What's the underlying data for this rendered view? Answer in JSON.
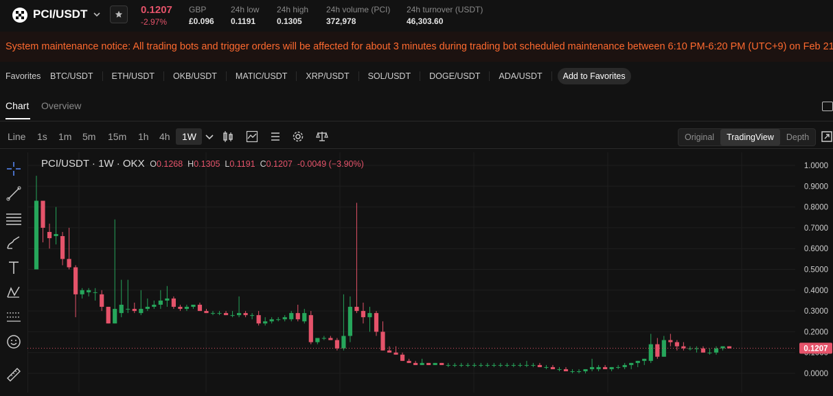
{
  "header": {
    "pair": "PCI/USDT",
    "price": "0.1207",
    "change": "-2.97%",
    "stats": [
      {
        "label": "GBP",
        "value": "£0.096"
      },
      {
        "label": "24h low",
        "value": "0.1191"
      },
      {
        "label": "24h high",
        "value": "0.1305"
      },
      {
        "label": "24h volume (PCI)",
        "value": "372,978"
      },
      {
        "label": "24h turnover (USDT)",
        "value": "46,303.60"
      }
    ]
  },
  "notice": "System maintenance notice: All trading bots and trigger orders will be affected for about 3 minutes during trading bot scheduled maintenance between 6:10 PM-6:20 PM (UTC+9) on Feb 21,",
  "favorites": {
    "label": "Favorites",
    "items": [
      "BTC/USDT",
      "ETH/USDT",
      "OKB/USDT",
      "MATIC/USDT",
      "XRP/USDT",
      "SOL/USDT",
      "DOGE/USDT",
      "ADA/USDT"
    ],
    "add_label": "Add to Favorites"
  },
  "tabs": {
    "chart": "Chart",
    "overview": "Overview"
  },
  "toolbar": {
    "timeframes": [
      "Line",
      "1s",
      "1m",
      "5m",
      "15m",
      "1h",
      "4h",
      "1W"
    ],
    "active_timeframe": "1W",
    "views": [
      "Original",
      "TradingView",
      "Depth"
    ],
    "active_view": "TradingView"
  },
  "colors": {
    "up": "#26a65b",
    "down": "#e5536a",
    "notice": "#ff6a2f"
  },
  "chart_data": {
    "type": "candlestick",
    "title": "PCI/USDT · 1W · OKX",
    "ohlc": {
      "o": "0.1268",
      "h": "0.1305",
      "l": "0.1191",
      "c": "0.1207",
      "chg": "-0.0049 (−3.90%)"
    },
    "y_axis_ticks": [
      "1.0000",
      "0.9000",
      "0.8000",
      "0.7000",
      "0.6000",
      "0.5000",
      "0.4000",
      "0.3000",
      "0.2000",
      "0.1000",
      "0.0000"
    ],
    "ylim": [
      0,
      1.0
    ],
    "last_price_label": "0.1207",
    "candles": [
      [
        0.5,
        0.95,
        0.5,
        0.83
      ],
      [
        0.83,
        0.83,
        0.63,
        0.7
      ],
      [
        0.68,
        0.72,
        0.6,
        0.65
      ],
      [
        0.66,
        0.8,
        0.62,
        0.67
      ],
      [
        0.66,
        0.68,
        0.52,
        0.55
      ],
      [
        0.55,
        0.7,
        0.5,
        0.51
      ],
      [
        0.51,
        0.52,
        0.27,
        0.38
      ],
      [
        0.38,
        0.41,
        0.36,
        0.4
      ],
      [
        0.39,
        0.41,
        0.37,
        0.4
      ],
      [
        0.39,
        0.41,
        0.35,
        0.39
      ],
      [
        0.38,
        0.4,
        0.3,
        0.32
      ],
      [
        0.32,
        0.32,
        0.24,
        0.24
      ],
      [
        0.24,
        0.74,
        0.24,
        0.31
      ],
      [
        0.29,
        0.45,
        0.27,
        0.33
      ],
      [
        0.31,
        0.45,
        0.29,
        0.31
      ],
      [
        0.31,
        0.34,
        0.29,
        0.3
      ],
      [
        0.29,
        0.4,
        0.28,
        0.31
      ],
      [
        0.31,
        0.36,
        0.3,
        0.32
      ],
      [
        0.32,
        0.35,
        0.31,
        0.33
      ],
      [
        0.33,
        0.4,
        0.31,
        0.35
      ],
      [
        0.35,
        0.42,
        0.32,
        0.36
      ],
      [
        0.36,
        0.37,
        0.31,
        0.32
      ],
      [
        0.32,
        0.33,
        0.3,
        0.31
      ],
      [
        0.31,
        0.33,
        0.3,
        0.32
      ],
      [
        0.32,
        0.33,
        0.31,
        0.33
      ],
      [
        0.33,
        0.34,
        0.3,
        0.3
      ],
      [
        0.3,
        0.31,
        0.29,
        0.29
      ],
      [
        0.29,
        0.3,
        0.28,
        0.29
      ],
      [
        0.29,
        0.3,
        0.28,
        0.29
      ],
      [
        0.29,
        0.3,
        0.28,
        0.28
      ],
      [
        0.28,
        0.3,
        0.27,
        0.28
      ],
      [
        0.28,
        0.37,
        0.27,
        0.29
      ],
      [
        0.29,
        0.3,
        0.27,
        0.28
      ],
      [
        0.28,
        0.29,
        0.26,
        0.28
      ],
      [
        0.28,
        0.3,
        0.23,
        0.24
      ],
      [
        0.24,
        0.27,
        0.23,
        0.25
      ],
      [
        0.25,
        0.27,
        0.24,
        0.26
      ],
      [
        0.26,
        0.27,
        0.25,
        0.26
      ],
      [
        0.26,
        0.28,
        0.25,
        0.27
      ],
      [
        0.26,
        0.3,
        0.25,
        0.29
      ],
      [
        0.29,
        0.33,
        0.25,
        0.26
      ],
      [
        0.25,
        0.31,
        0.24,
        0.29
      ],
      [
        0.28,
        0.3,
        0.14,
        0.15
      ],
      [
        0.15,
        0.17,
        0.14,
        0.17
      ],
      [
        0.17,
        0.18,
        0.16,
        0.17
      ],
      [
        0.17,
        0.18,
        0.16,
        0.16
      ],
      [
        0.16,
        0.17,
        0.11,
        0.12
      ],
      [
        0.12,
        0.38,
        0.11,
        0.18
      ],
      [
        0.18,
        0.37,
        0.15,
        0.32
      ],
      [
        0.32,
        0.82,
        0.29,
        0.3
      ],
      [
        0.3,
        0.34,
        0.24,
        0.27
      ],
      [
        0.27,
        0.32,
        0.2,
        0.29
      ],
      [
        0.29,
        0.3,
        0.18,
        0.2
      ],
      [
        0.2,
        0.25,
        0.11,
        0.11
      ],
      [
        0.11,
        0.13,
        0.1,
        0.1
      ],
      [
        0.1,
        0.13,
        0.09,
        0.09
      ],
      [
        0.09,
        0.1,
        0.06,
        0.06
      ],
      [
        0.06,
        0.07,
        0.05,
        0.05
      ],
      [
        0.05,
        0.06,
        0.04,
        0.04
      ],
      [
        0.04,
        0.07,
        0.04,
        0.05
      ],
      [
        0.05,
        0.05,
        0.04,
        0.04
      ],
      [
        0.04,
        0.05,
        0.04,
        0.05
      ],
      [
        0.05,
        0.05,
        0.04,
        0.04
      ],
      [
        0.04,
        0.05,
        0.03,
        0.04
      ],
      [
        0.04,
        0.05,
        0.03,
        0.04
      ],
      [
        0.04,
        0.05,
        0.03,
        0.04
      ],
      [
        0.04,
        0.05,
        0.03,
        0.04
      ],
      [
        0.04,
        0.05,
        0.03,
        0.04
      ],
      [
        0.04,
        0.05,
        0.03,
        0.04
      ],
      [
        0.04,
        0.05,
        0.03,
        0.04
      ],
      [
        0.04,
        0.05,
        0.03,
        0.04
      ],
      [
        0.04,
        0.05,
        0.03,
        0.04
      ],
      [
        0.04,
        0.05,
        0.03,
        0.04
      ],
      [
        0.04,
        0.05,
        0.03,
        0.04
      ],
      [
        0.04,
        0.05,
        0.03,
        0.04
      ],
      [
        0.04,
        0.06,
        0.03,
        0.04
      ],
      [
        0.04,
        0.05,
        0.03,
        0.04
      ],
      [
        0.04,
        0.05,
        0.03,
        0.03
      ],
      [
        0.03,
        0.04,
        0.02,
        0.03
      ],
      [
        0.03,
        0.04,
        0.02,
        0.02
      ],
      [
        0.02,
        0.03,
        0.01,
        0.02
      ],
      [
        0.02,
        0.03,
        0.01,
        0.01
      ],
      [
        0.01,
        0.02,
        0.0,
        0.01
      ],
      [
        0.01,
        0.02,
        0.0,
        0.01
      ],
      [
        0.01,
        0.02,
        0.0,
        0.02
      ],
      [
        0.02,
        0.07,
        0.01,
        0.03
      ],
      [
        0.02,
        0.04,
        0.01,
        0.03
      ],
      [
        0.03,
        0.04,
        0.02,
        0.02
      ],
      [
        0.02,
        0.03,
        0.01,
        0.03
      ],
      [
        0.03,
        0.04,
        0.02,
        0.03
      ],
      [
        0.03,
        0.05,
        0.02,
        0.04
      ],
      [
        0.04,
        0.05,
        0.02,
        0.05
      ],
      [
        0.05,
        0.06,
        0.03,
        0.06
      ],
      [
        0.06,
        0.07,
        0.04,
        0.07
      ],
      [
        0.06,
        0.19,
        0.05,
        0.14
      ],
      [
        0.14,
        0.17,
        0.07,
        0.08
      ],
      [
        0.08,
        0.18,
        0.08,
        0.16
      ],
      [
        0.16,
        0.19,
        0.13,
        0.15
      ],
      [
        0.15,
        0.16,
        0.11,
        0.13
      ],
      [
        0.13,
        0.15,
        0.11,
        0.12
      ],
      [
        0.12,
        0.13,
        0.11,
        0.12
      ],
      [
        0.12,
        0.13,
        0.1,
        0.12
      ],
      [
        0.12,
        0.13,
        0.1,
        0.1
      ],
      [
        0.1,
        0.12,
        0.09,
        0.1
      ],
      [
        0.1,
        0.13,
        0.09,
        0.12
      ],
      [
        0.12,
        0.13,
        0.11,
        0.13
      ],
      [
        0.13,
        0.13,
        0.12,
        0.12
      ]
    ]
  }
}
